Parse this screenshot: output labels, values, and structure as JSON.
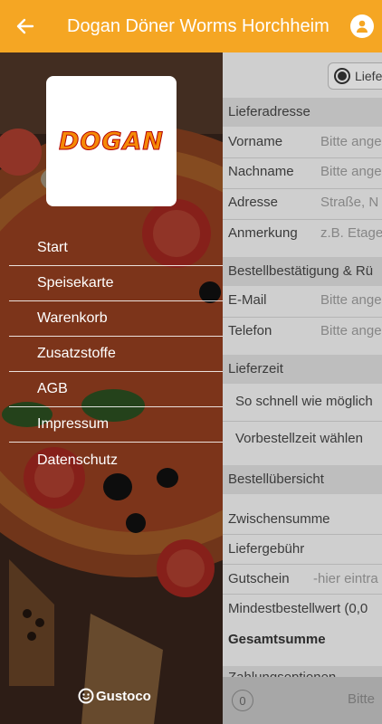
{
  "header": {
    "title": "Dogan Döner Worms Horchheim"
  },
  "drawer": {
    "logo_text": "DOGAN",
    "menu": [
      {
        "label": "Start"
      },
      {
        "label": "Speisekarte"
      },
      {
        "label": "Warenkorb"
      },
      {
        "label": "Zusatzstoffe"
      },
      {
        "label": "AGB"
      },
      {
        "label": "Impressum"
      },
      {
        "label": "Datenschutz"
      }
    ],
    "brand": "Gustoco"
  },
  "form": {
    "delivery_option": "Liefe",
    "sections": {
      "address": "Lieferadresse",
      "confirmation": "Bestellbestätigung & Rü",
      "delivery_time": "Lieferzeit",
      "overview": "Bestellübersicht",
      "payment": "Zahlungsoptionen"
    },
    "fields": {
      "firstname": {
        "label": "Vorname",
        "placeholder": "Bitte ange"
      },
      "lastname": {
        "label": "Nachname",
        "placeholder": "Bitte ange"
      },
      "address": {
        "label": "Adresse",
        "placeholder": "Straße, N"
      },
      "note": {
        "label": "Anmerkung",
        "placeholder": "z.B. Etage"
      },
      "email": {
        "label": "E-Mail",
        "placeholder": "Bitte ange"
      },
      "phone": {
        "label": "Telefon",
        "placeholder": "Bitte ange"
      },
      "voucher": {
        "label": "Gutschein",
        "placeholder": "-hier eintra"
      }
    },
    "time_options": [
      "So schnell wie möglich",
      "Vorbestellzeit wählen"
    ],
    "summary": {
      "subtotal": "Zwischensumme",
      "delivery_fee": "Liefergebühr",
      "min_order": "Mindestbestellwert (0,0",
      "total": "Gesamtsumme"
    },
    "cart_count": "0",
    "bottom_button": "Bitte"
  }
}
